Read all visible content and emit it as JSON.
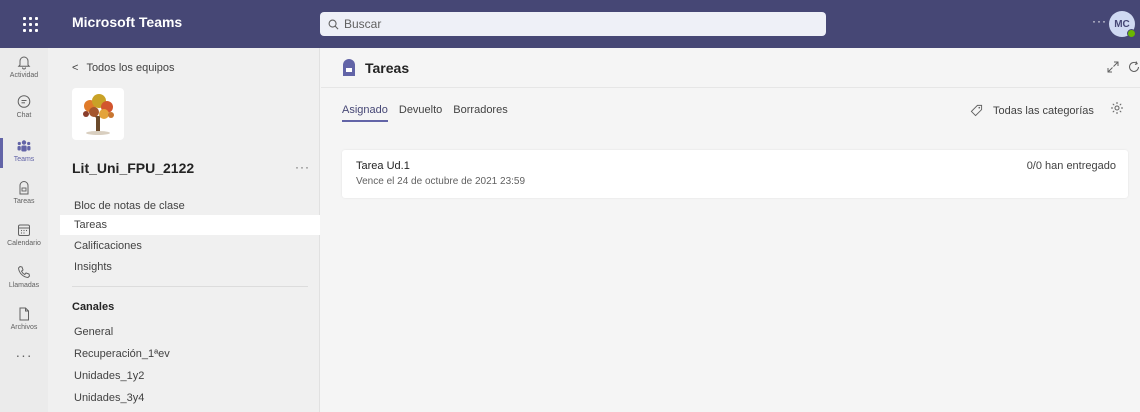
{
  "topbar": {
    "app_title": "Microsoft Teams",
    "search_placeholder": "Buscar",
    "more_label": "···",
    "avatar_initials": "MC"
  },
  "rail": {
    "items": [
      {
        "label": "Actividad",
        "icon": "bell-icon"
      },
      {
        "label": "Chat",
        "icon": "chat-icon"
      },
      {
        "label": "Teams",
        "icon": "teams-icon"
      },
      {
        "label": "Tareas",
        "icon": "assignments-icon"
      },
      {
        "label": "Calendario",
        "icon": "calendar-icon"
      },
      {
        "label": "Llamadas",
        "icon": "phone-icon"
      },
      {
        "label": "Archivos",
        "icon": "file-icon"
      }
    ],
    "more_label": "···",
    "active_color": "#6264a7"
  },
  "panel": {
    "back_label": "Todos los equipos",
    "team_name": "Lit_Uni_FPU_2122",
    "team_more": "···",
    "nav": [
      {
        "label": "Bloc de notas de clase"
      },
      {
        "label": "Tareas",
        "selected": true
      },
      {
        "label": "Calificaciones"
      },
      {
        "label": "Insights"
      }
    ],
    "channels_title": "Canales",
    "channels": [
      {
        "label": "General"
      },
      {
        "label": "Recuperación_1ªev"
      },
      {
        "label": "Unidades_1y2"
      },
      {
        "label": "Unidades_3y4"
      }
    ]
  },
  "main": {
    "title": "Tareas",
    "tabs": [
      {
        "label": "Asignado",
        "active": true
      },
      {
        "label": "Devuelto"
      },
      {
        "label": "Borradores"
      }
    ],
    "category_filter": "Todas las categorías",
    "assignment": {
      "title": "Tarea Ud.1",
      "due": "Vence el 24 de octubre de 2021 23:59",
      "status": "0/0 han entregado"
    }
  },
  "colors": {
    "topbar": "#464775",
    "accent": "#6264a7",
    "presence": "#6bb700"
  }
}
